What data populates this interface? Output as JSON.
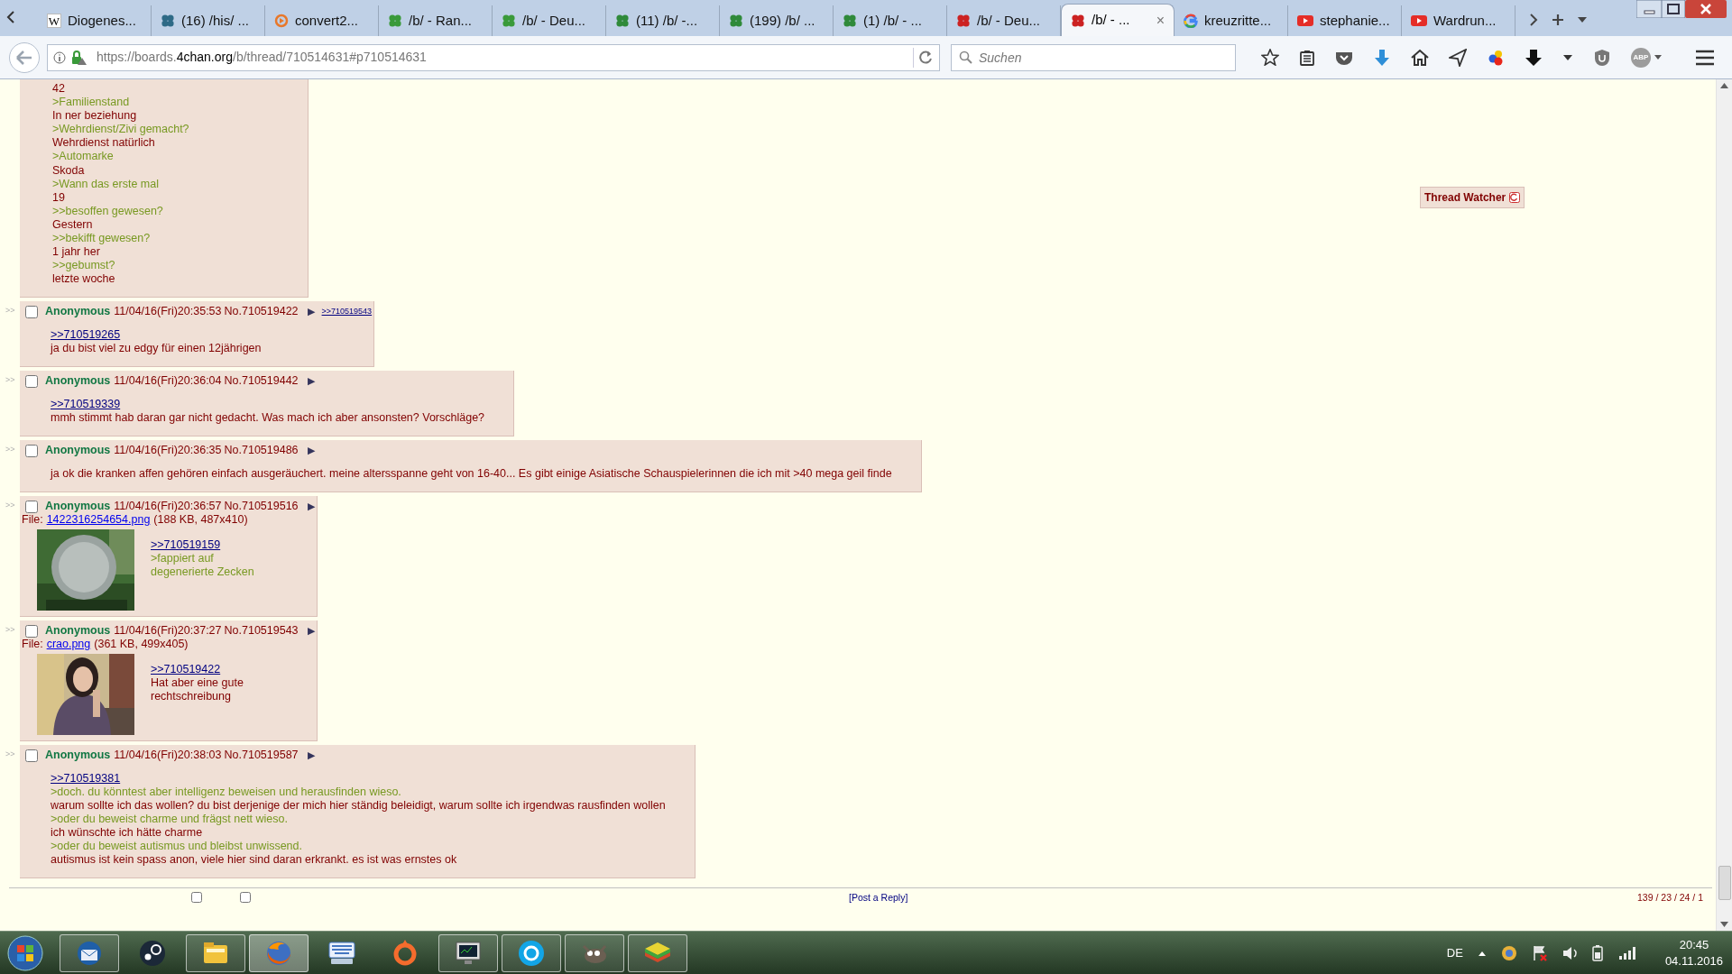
{
  "browser": {
    "tabs": [
      {
        "title": "Diogenes...",
        "kind": "wikipedia",
        "icon_text": "W",
        "selected": false
      },
      {
        "title": "(16) /his/ ...",
        "kind": "clover",
        "color": "#2e6a86",
        "selected": false
      },
      {
        "title": "convert2...",
        "kind": "ring",
        "selected": false
      },
      {
        "title": "/b/ - Ran...",
        "kind": "clover",
        "color": "#3a9a3a",
        "selected": false
      },
      {
        "title": "/b/ - Deu...",
        "kind": "clover",
        "color": "#3a9a3a",
        "selected": false
      },
      {
        "title": "(11) /b/ -...",
        "kind": "clover",
        "color": "#2f8a3a",
        "selected": false
      },
      {
        "title": "(199) /b/ ...",
        "kind": "clover",
        "color": "#2f8a3a",
        "selected": false
      },
      {
        "title": "(1) /b/ - ...",
        "kind": "clover",
        "color": "#2f8a3a",
        "selected": false
      },
      {
        "title": "/b/ - Deu...",
        "kind": "clover",
        "color": "#cc2222",
        "selected": false
      },
      {
        "title": "/b/ - ...",
        "kind": "clover",
        "color": "#cc2222",
        "selected": true,
        "close_label": "×"
      },
      {
        "title": "kreuzritte...",
        "kind": "google",
        "selected": false
      },
      {
        "title": "stephanie...",
        "kind": "youtube",
        "selected": false
      },
      {
        "title": "Wardrun...",
        "kind": "youtube",
        "selected": false
      }
    ],
    "url": {
      "prefix": "https://boards.",
      "domain": "4chan.org",
      "path": "/b/thread/710514631#p710514631"
    },
    "search_placeholder": "Suchen",
    "adblock_label": "ABP"
  },
  "thread": {
    "op_tail": [
      {
        "kind": "text",
        "text": "42"
      },
      {
        "kind": "quote",
        "text": ">Familienstand"
      },
      {
        "kind": "text",
        "text": "In ner beziehung"
      },
      {
        "kind": "quote",
        "text": ">Wehrdienst/Zivi gemacht?"
      },
      {
        "kind": "text",
        "text": "Wehrdienst natürlich"
      },
      {
        "kind": "quote",
        "text": ">Automarke"
      },
      {
        "kind": "text",
        "text": "Skoda"
      },
      {
        "kind": "quote",
        "text": ">Wann das erste mal"
      },
      {
        "kind": "text",
        "text": "19"
      },
      {
        "kind": "quote",
        "text": ">>besoffen gewesen?"
      },
      {
        "kind": "text",
        "text": "Gestern"
      },
      {
        "kind": "quote",
        "text": ">>bekifft gewesen?"
      },
      {
        "kind": "text",
        "text": "1 jahr her"
      },
      {
        "kind": "quote",
        "text": ">>gebumst?"
      },
      {
        "kind": "text",
        "text": "letzte woche"
      }
    ],
    "posts": [
      {
        "side_marker": ">>",
        "checked": false,
        "name": "Anonymous",
        "datetime": "11/04/16(Fri)20:35:53",
        "number": "No.710519422",
        "arrow": "▶",
        "backlinks": [
          ">>710519543"
        ],
        "lines": [
          {
            "kind": "link",
            "text": ">>710519265"
          },
          {
            "kind": "text",
            "text": "ja du bist viel zu edgy für einen 12jährigen"
          }
        ]
      },
      {
        "side_marker": ">>",
        "checked": false,
        "name": "Anonymous",
        "datetime": "11/04/16(Fri)20:36:04",
        "number": "No.710519442",
        "arrow": "▶",
        "lines": [
          {
            "kind": "link",
            "text": ">>710519339"
          },
          {
            "kind": "text",
            "text": "mmh stimmt hab daran gar nicht gedacht. Was mach ich aber ansonsten? Vorschläge?"
          }
        ]
      },
      {
        "side_marker": ">>",
        "checked": false,
        "name": "Anonymous",
        "datetime": "11/04/16(Fri)20:36:35",
        "number": "No.710519486",
        "arrow": "▶",
        "lines": [
          {
            "kind": "text",
            "text": "ja ok die kranken affen gehören einfach ausgeräuchert. meine altersspanne geht von 16-40... Es gibt einige Asiatische Schauspielerinnen die ich mit >40 mega geil finde"
          }
        ]
      },
      {
        "side_marker": ">>",
        "checked": false,
        "name": "Anonymous",
        "datetime": "11/04/16(Fri)20:36:57",
        "number": "No.710519516",
        "arrow": "▶",
        "file": {
          "label": "File:",
          "name": "1422316254654.png",
          "info": "(188 KB, 487x410)"
        },
        "lines": [
          {
            "kind": "link",
            "text": ">>710519159"
          },
          {
            "kind": "quote",
            "text": ">fappiert auf"
          },
          {
            "kind": "quote",
            "text": "degenerierte Zecken"
          }
        ]
      },
      {
        "side_marker": ">>",
        "checked": false,
        "name": "Anonymous",
        "datetime": "11/04/16(Fri)20:37:27",
        "number": "No.710519543",
        "arrow": "▶",
        "file": {
          "label": "File:",
          "name": "crao.png",
          "info": "(361 KB, 499x405)"
        },
        "lines": [
          {
            "kind": "link",
            "text": ">>710519422"
          },
          {
            "kind": "text",
            "text": "Hat aber eine gute"
          },
          {
            "kind": "text",
            "text": "rechtschreibung"
          }
        ]
      },
      {
        "side_marker": ">>",
        "checked": false,
        "name": "Anonymous",
        "datetime": "11/04/16(Fri)20:38:03",
        "number": "No.710519587",
        "arrow": "▶",
        "lines": [
          {
            "kind": "link",
            "text": ">>710519381"
          },
          {
            "kind": "quote",
            "text": ">doch. du könntest aber intelligenz beweisen und herausfinden wieso."
          },
          {
            "kind": "text",
            "text": "warum sollte ich das wollen? du bist derjenige der mich hier ständig beleidigt, warum sollte ich irgendwas rausfinden wollen"
          },
          {
            "kind": "quote",
            "text": ">oder du beweist charme und frägst nett wieso."
          },
          {
            "kind": "text",
            "text": "ich wünschte ich hätte charme"
          },
          {
            "kind": "quote",
            "text": ">oder du beweist autismus und bleibst unwissend."
          },
          {
            "kind": "text",
            "text": "autismus ist kein spass anon, viele hier sind daran erkrankt. es ist was ernstes ok"
          }
        ]
      }
    ]
  },
  "thread_watcher": "Thread Watcher",
  "footer": {
    "checkboxes": [
      {
        "checked": false
      },
      {
        "checked": false
      }
    ],
    "post_reply": "[Post a Reply]",
    "stats": "139 / 23 / 24 / 1"
  },
  "taskbar": {
    "apps": [
      {
        "kind": "thunderbird",
        "running": true,
        "selected": false
      },
      {
        "kind": "steam",
        "running": false,
        "selected": false
      },
      {
        "kind": "explorer",
        "running": true,
        "selected": false
      },
      {
        "kind": "firefox",
        "running": true,
        "selected": true
      },
      {
        "kind": "keyboard",
        "running": false,
        "selected": false
      },
      {
        "kind": "origin",
        "running": false,
        "selected": false
      },
      {
        "kind": "monitor",
        "running": true,
        "selected": false
      },
      {
        "kind": "skype",
        "running": true,
        "selected": false
      },
      {
        "kind": "gimp",
        "running": true,
        "selected": false
      },
      {
        "kind": "bluestacks",
        "running": true,
        "selected": false
      }
    ],
    "language": "DE",
    "time": "20:45",
    "date": "04.11.2016"
  }
}
